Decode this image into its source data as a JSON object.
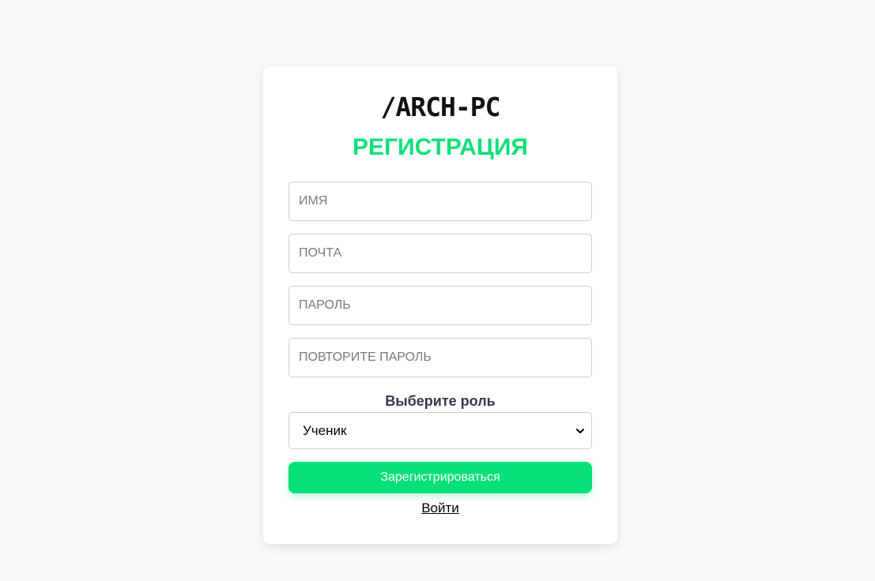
{
  "brand": {
    "logo_text": "/ARCH-PC"
  },
  "form": {
    "title": "РЕГИСТРАЦИЯ",
    "fields": [
      {
        "placeholder": "ИМЯ",
        "value": ""
      },
      {
        "placeholder": "ПОЧТА",
        "value": ""
      },
      {
        "placeholder": "ПАРОЛЬ",
        "value": ""
      },
      {
        "placeholder": "ПОВТОРИТЕ ПАРОЛЬ",
        "value": ""
      }
    ],
    "role_label": "Выберите роль",
    "role_selected": "Ученик",
    "submit_label": "Зарегистрироваться",
    "login_link_label": "Войти"
  },
  "colors": {
    "accent": "#06e079",
    "title": "#0ee07a",
    "background": "#f8f9fa"
  },
  "icons": {
    "select_arrow": "chevron-down-icon"
  }
}
